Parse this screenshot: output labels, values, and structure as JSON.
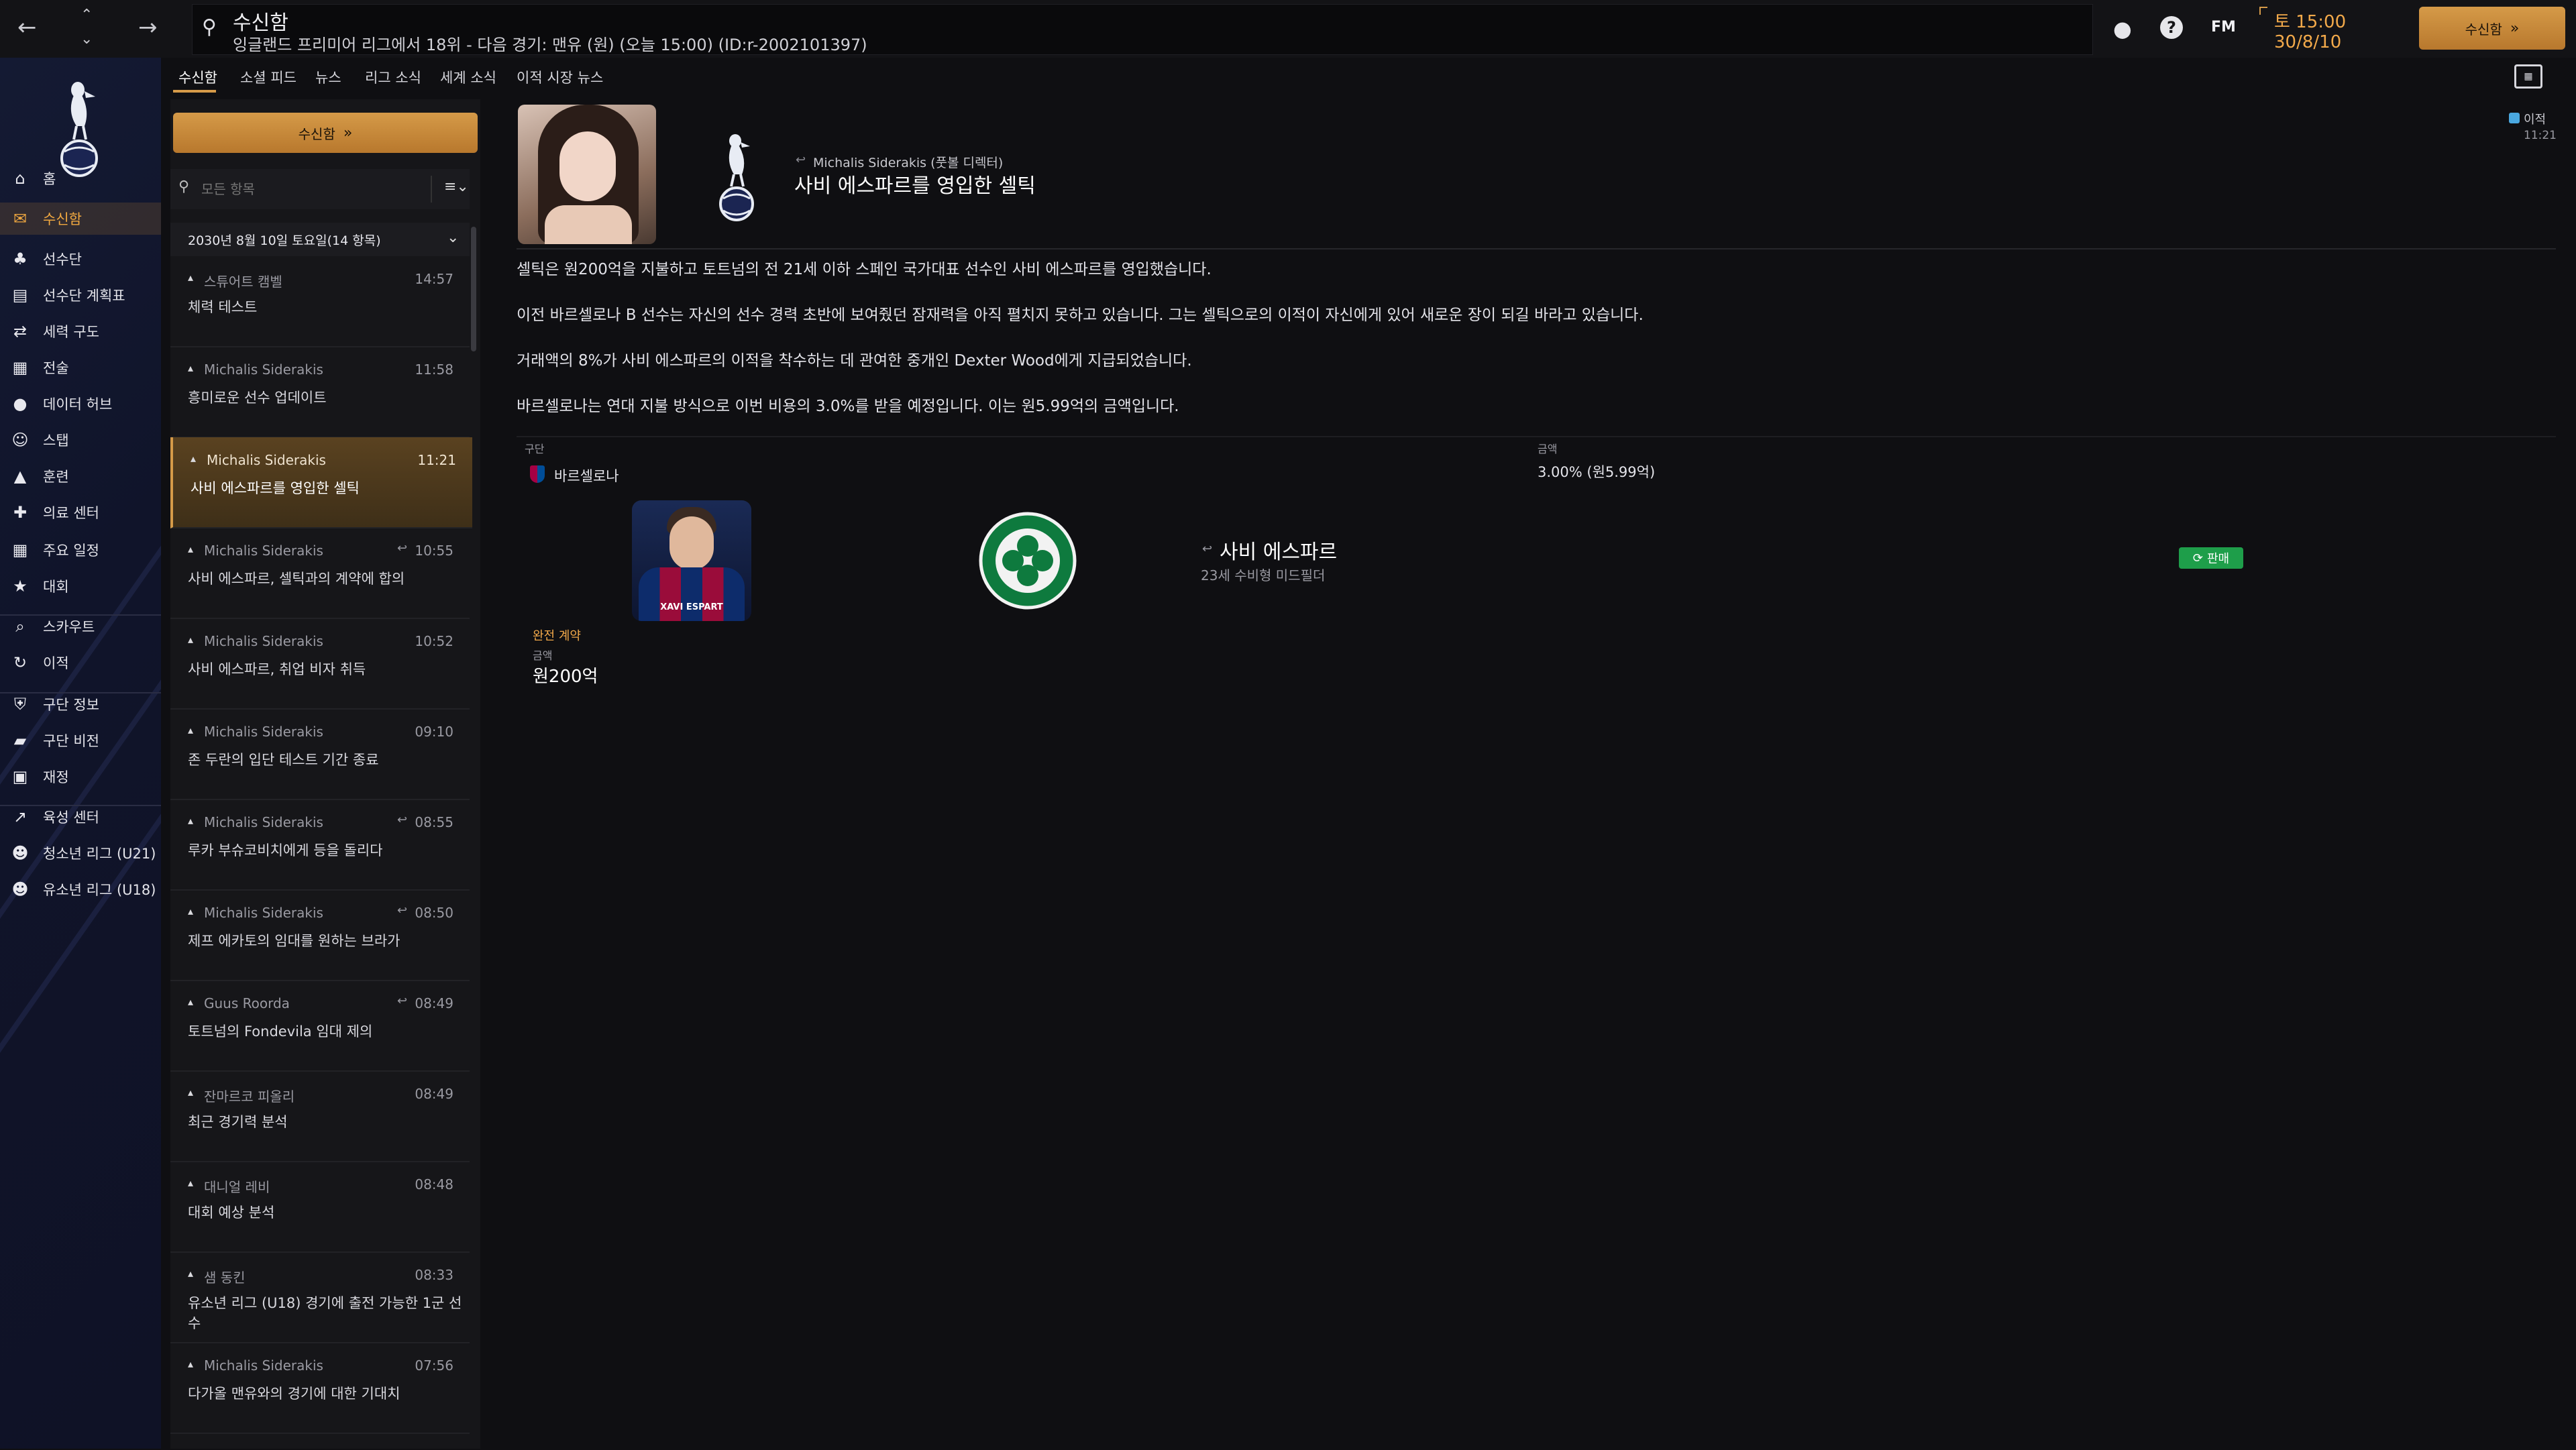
{
  "topbar": {
    "back_icon": "arrow-left",
    "forward_icon": "arrow-right",
    "search_title": "수신함",
    "search_subtitle": "잉글랜드 프리미어 리그에서 18위 - 다음 경기: 맨유 (원) (오늘 15:00) (ID:r-2002101397)",
    "date_time": "토 15:00",
    "date_day": "30/8/10",
    "fm_label": "FM",
    "inbox_button": "수신함"
  },
  "sidebar": {
    "items": [
      {
        "label": "홈",
        "icon": "home-icon"
      },
      {
        "label": "수신함",
        "icon": "inbox-icon"
      },
      {
        "label": "선수단",
        "icon": "shirt-icon"
      },
      {
        "label": "선수단 계획표",
        "icon": "clipboard-icon"
      },
      {
        "label": "세력 구도",
        "icon": "dynamics-icon"
      },
      {
        "label": "전술",
        "icon": "tactics-icon"
      },
      {
        "label": "데이터 허브",
        "icon": "data-icon"
      },
      {
        "label": "스탭",
        "icon": "staff-icon"
      },
      {
        "label": "훈련",
        "icon": "training-icon"
      },
      {
        "label": "의료 센터",
        "icon": "medical-icon"
      },
      {
        "label": "주요 일정",
        "icon": "calendar-icon"
      },
      {
        "label": "대회",
        "icon": "trophy-icon"
      },
      {
        "label": "스카우트",
        "icon": "scout-icon"
      },
      {
        "label": "이적",
        "icon": "transfer-icon"
      },
      {
        "label": "구단 정보",
        "icon": "shield-icon"
      },
      {
        "label": "구단 비전",
        "icon": "vision-icon"
      },
      {
        "label": "재정",
        "icon": "finance-icon"
      },
      {
        "label": "육성 센터",
        "icon": "development-icon"
      },
      {
        "label": "청소년 리그 (U21)",
        "icon": "youth-icon"
      },
      {
        "label": "유소년 리그 (U18)",
        "icon": "youth-icon"
      }
    ]
  },
  "tabs": [
    "수신함",
    "소셜 피드",
    "뉴스",
    "리그 소식",
    "세계 소식",
    "이적 시장 뉴스"
  ],
  "list": {
    "inbox_button": "수신함",
    "filter_placeholder": "모든 항목",
    "date_header": "2030년 8월 10일 토요일(14 항목)",
    "messages": [
      {
        "sender": "스튜어트 캠벨",
        "time": "14:57",
        "subject": "체력 테스트"
      },
      {
        "sender": "Michalis Siderakis",
        "time": "11:58",
        "subject": "흥미로운 선수 업데이트"
      },
      {
        "sender": "Michalis Siderakis",
        "time": "11:21",
        "subject": "사비 에스파르를 영입한 셀틱"
      },
      {
        "sender": "Michalis Siderakis",
        "time": "10:55",
        "subject": "사비 에스파르, 셀틱과의 계약에 합의"
      },
      {
        "sender": "Michalis Siderakis",
        "time": "10:52",
        "subject": "사비 에스파르, 취업 비자 취득"
      },
      {
        "sender": "Michalis Siderakis",
        "time": "09:10",
        "subject": "존 두란의 입단 테스트 기간 종료"
      },
      {
        "sender": "Michalis Siderakis",
        "time": "08:55",
        "subject": "루카 부슈코비치에게 등을 돌리다"
      },
      {
        "sender": "Michalis Siderakis",
        "time": "08:50",
        "subject": "제프 에카토의 임대를 원하는 브라가"
      },
      {
        "sender": "Guus Roorda",
        "time": "08:49",
        "subject": "토트넘의 Fondevila 임대 제의"
      },
      {
        "sender": "잔마르코 피올리",
        "time": "08:49",
        "subject": "최근 경기력 분석"
      },
      {
        "sender": "대니얼 레비",
        "time": "08:48",
        "subject": "대회 예상 분석"
      },
      {
        "sender": "샘 동킨",
        "time": "08:33",
        "subject": "유소년 리그 (U18) 경기에 출전 가능한 1군 선수"
      },
      {
        "sender": "Michalis Siderakis",
        "time": "07:56",
        "subject": "다가올 맨유와의 경기에 대한 기대치"
      }
    ]
  },
  "detail": {
    "author": "Michalis Siderakis (풋볼 디렉터)",
    "headline": "사비 에스파르를 영입한 셀틱",
    "tag": "이적",
    "tag_time": "11:21",
    "paragraphs": [
      "셀틱은 원200억을 지불하고 토트넘의 전 21세 이하 스페인 국가대표 선수인 사비 에스파르를 영입했습니다.",
      "이전 바르셀로나 B 선수는 자신의 선수 경력 초반에 보여줬던 잠재력을 아직 펼치지 못하고 있습니다. 그는 셀틱으로의 이적이 자신에게 있어 새로운 장이 되길 바라고 있습니다.",
      "거래액의 8%가 사비 에스파르의 이적을 착수하는 데 관여한 중개인 Dexter Wood에게 지급되었습니다.",
      "바르셀로나는 연대 지불 방식으로 이번 비용의 3.0%를 받을 예정입니다. 이는 원5.99억의 금액입니다."
    ],
    "table": {
      "col_club": "구단",
      "col_amount": "금액",
      "club": "바르셀로나",
      "amount": "3.00% (원5.99억)"
    },
    "player": {
      "name": "사비 에스파르",
      "desc": "23세 수비형 미드필더",
      "shirt_text": "XAVI ESPART",
      "status": "판매"
    },
    "fee": {
      "type": "완전 계약",
      "label": "금액",
      "value": "원200억"
    }
  },
  "colors": {
    "accent": "#d59a48",
    "accent_text": "#f2a94a",
    "status_green": "#1e9e4a"
  }
}
